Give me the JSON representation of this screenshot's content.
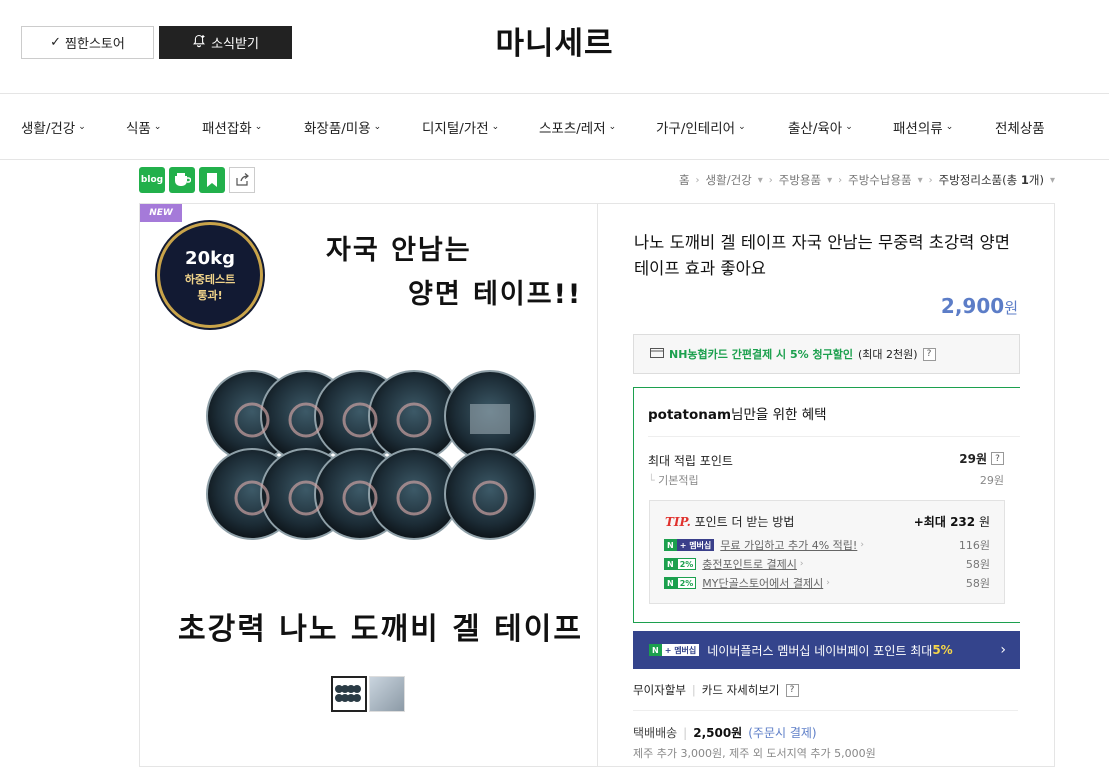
{
  "header": {
    "zzim_label": "찜한스토어",
    "alarm_label": "소식받기",
    "store_name": "마니세르"
  },
  "nav": {
    "items": [
      {
        "label": "생활/건강",
        "chevron": true
      },
      {
        "label": "식품",
        "chevron": true
      },
      {
        "label": "패션잡화",
        "chevron": true
      },
      {
        "label": "화장품/미용",
        "chevron": true
      },
      {
        "label": "디지털/가전",
        "chevron": true
      },
      {
        "label": "스포츠/레저",
        "chevron": true
      },
      {
        "label": "가구/인테리어",
        "chevron": true
      },
      {
        "label": "출산/육아",
        "chevron": true
      },
      {
        "label": "패션의류",
        "chevron": true
      },
      {
        "label": "전체상품",
        "chevron": false
      }
    ]
  },
  "share": {
    "blog_label": "blog"
  },
  "breadcrumb": {
    "items": [
      "홈",
      "생활/건강",
      "주방용품",
      "주방수납용품"
    ],
    "last": "주방정리소품",
    "count_prefix": "(총 ",
    "count": "1",
    "count_suffix": "개)"
  },
  "image": {
    "badge": "NEW",
    "seal_kg": "20kg",
    "seal_line2": "하중테스트",
    "seal_line3": "통과!",
    "headline1": "자국 안남는",
    "headline2": "양면 테이프!!",
    "footer": "초강력 나노 도깨비 겔 테이프"
  },
  "product": {
    "title": "나노 도깨비 겔 테이프 자국 안남는 무중력 초강력 양면 테이프 효과 좋아요",
    "price": "2,900",
    "price_unit": "원"
  },
  "nh_card": {
    "text": "NH농협카드 간편결제 시 5% 청구할인",
    "suffix": "(최대 2천원)",
    "q": "?"
  },
  "benefit": {
    "user": "potatonam",
    "title_suffix": "님만을 위한 혜택",
    "max_point_label": "최대 적립 포인트",
    "max_point_value": "29원",
    "base_label": "기본적립",
    "base_value": "29원",
    "tip_word": "TIP.",
    "tip_text": "포인트 더 받는 방법",
    "tip_max_prefix": "+최대 ",
    "tip_max_value": "232",
    "tip_max_unit": " 원",
    "rows": [
      {
        "tag_n": "N",
        "tag_t": "+ 멤버십",
        "label": "무료 가입하고 추가 4% 적립!",
        "value": "116원"
      },
      {
        "tag_n": "N",
        "tag_p": "2%",
        "label": "충전포인트로 결제시",
        "value": "58원"
      },
      {
        "tag_n": "N",
        "tag_p": "2%",
        "label": "MY단골스토어에서 결제시",
        "value": "58원"
      }
    ]
  },
  "membership": {
    "tag_n": "N",
    "tag_t": "+ 멤버십",
    "text": "네이버플러스 멤버십 네이버페이 포인트 최대 ",
    "highlight": "5%",
    "arrow": "›"
  },
  "card_info": {
    "installment": "무이자할부",
    "detail": "카드 자세히보기",
    "q": "?"
  },
  "shipping": {
    "label": "택배배송",
    "price": "2,500원",
    "note": "(주문시 결제)",
    "extra": "제주 추가 3,000원, 제주 외 도서지역 추가 5,000원"
  },
  "colors": {
    "price": "#5c7dc7",
    "naver_green": "#1ca04e",
    "membership_bg": "#34448c",
    "new_badge": "#a57ad9"
  }
}
